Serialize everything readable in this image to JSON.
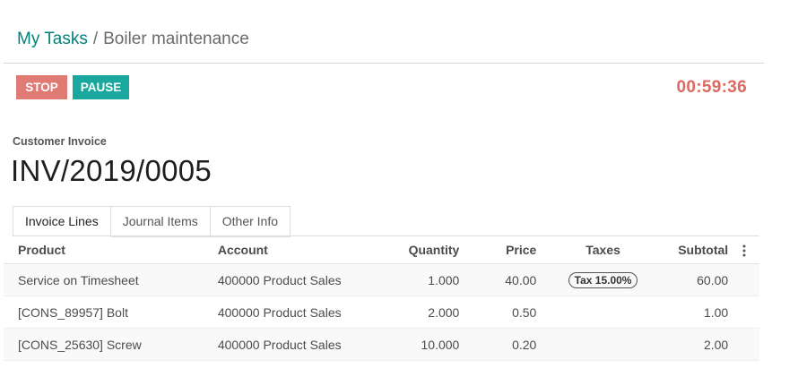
{
  "breadcrumb": {
    "parent": "My Tasks",
    "separator": "/",
    "current": "Boiler maintenance"
  },
  "actions": {
    "stop_label": "STOP",
    "pause_label": "PAUSE"
  },
  "timer": "00:59:36",
  "document": {
    "type_label": "Customer Invoice",
    "name": "INV/2019/0005"
  },
  "tabs": [
    {
      "label": "Invoice Lines",
      "active": true
    },
    {
      "label": "Journal Items",
      "active": false
    },
    {
      "label": "Other Info",
      "active": false
    }
  ],
  "table": {
    "headers": {
      "product": "Product",
      "account": "Account",
      "quantity": "Quantity",
      "price": "Price",
      "taxes": "Taxes",
      "subtotal": "Subtotal"
    },
    "rows": [
      {
        "product": "Service on Timesheet",
        "account": "400000 Product Sales",
        "quantity": "1.000",
        "price": "40.00",
        "taxes": "Tax 15.00%",
        "subtotal": "60.00"
      },
      {
        "product": "[CONS_89957] Bolt",
        "account": "400000 Product Sales",
        "quantity": "2.000",
        "price": "0.50",
        "taxes": "",
        "subtotal": "1.00"
      },
      {
        "product": "[CONS_25630] Screw",
        "account": "400000 Product Sales",
        "quantity": "10.000",
        "price": "0.20",
        "taxes": "",
        "subtotal": "2.00"
      }
    ]
  },
  "colors": {
    "link_teal": "#00827a",
    "stop_red": "#e07a74",
    "pause_teal": "#1aa89e",
    "timer_red": "#dc6a61"
  },
  "icons": {
    "column_options": "kebab-vertical-icon"
  }
}
